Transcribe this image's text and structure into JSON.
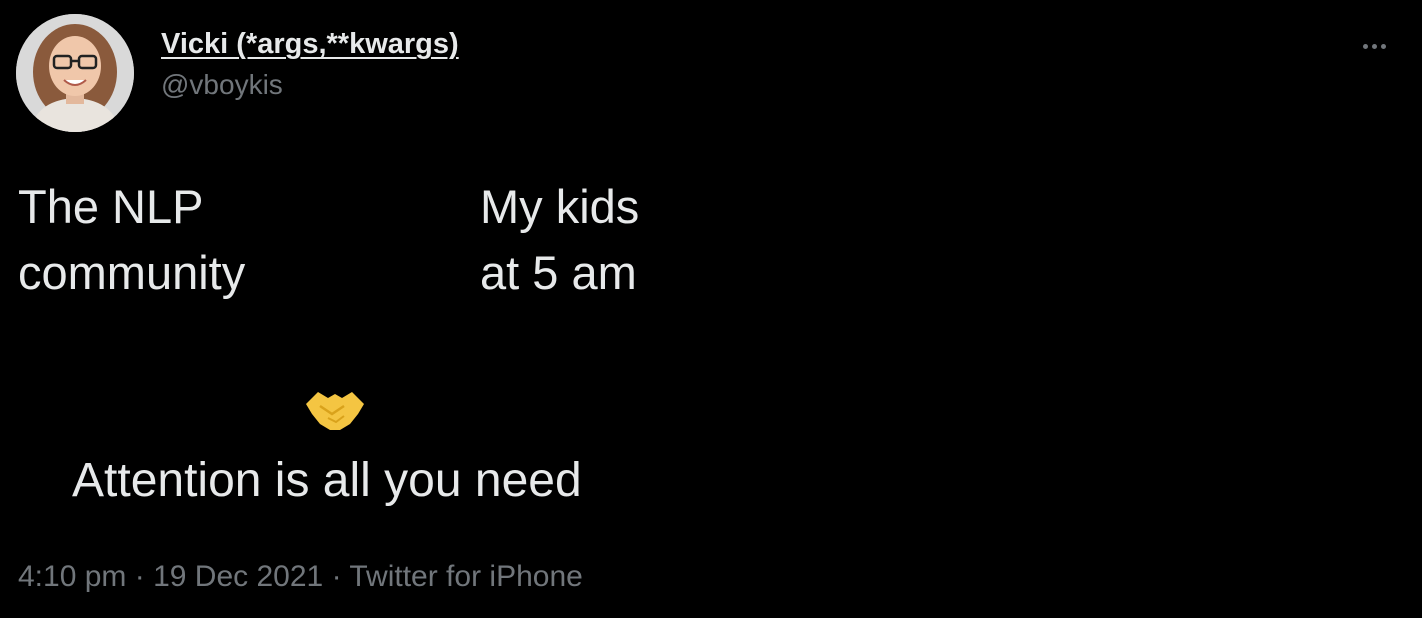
{
  "author": {
    "display_name": "Vicki (*args,**kwargs)",
    "handle": "@vboykis"
  },
  "meme": {
    "left_caption": [
      "The NLP",
      "community"
    ],
    "right_caption": [
      "My kids",
      "at 5 am"
    ],
    "bottom_caption": "Attention is all you need",
    "emoji_icon": "handshake-emoji"
  },
  "meta": {
    "time": "4:10 pm",
    "separator": "·",
    "date": "19 Dec 2021",
    "source": "Twitter for iPhone"
  },
  "colors": {
    "background": "#000000",
    "text": "#e7e9ea",
    "secondary": "#71767b",
    "emoji": "#f4c542"
  }
}
